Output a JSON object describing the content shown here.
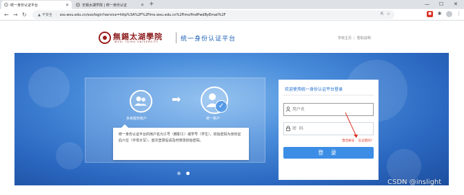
{
  "browser": {
    "tabs": [
      {
        "title": "统一身份认证平台",
        "active": true
      },
      {
        "title": "无锡太湖学院 | 统一身份认证",
        "active": false
      }
    ],
    "new_tab": "+",
    "window_controls": {
      "minimize": "—",
      "maximize": "☐",
      "close": "✕"
    },
    "nav": {
      "back": "←",
      "forward": "→",
      "reload": "↻"
    },
    "address": {
      "security_icon": "▲",
      "security_label": "不安全",
      "url": "sso.wxu.edu.cn/sso/login?service=http%3A%2F%2Fims.wxu.edu.cn%2Fims/findPwdByEmail%2F"
    }
  },
  "site": {
    "logo_cn": "無錫太湖學院",
    "logo_en": "WUXI TAIHU UNIVERSITY",
    "platform_title": "统一身份认证平台",
    "links": [
      "学校主页",
      "帮助说明"
    ]
  },
  "banner": {
    "multi_label": "多条服务账户",
    "single_label": "统一账户",
    "description": "统一身份认证平台的用户名为工号（教职工）或学号（学生），初始密码为身份证后六位（字母大写），首次登录后请及时修改初始密码。",
    "carousel_dots": 2,
    "active_dot": 2
  },
  "login": {
    "title": "欢迎使用统一身份认证平台登录",
    "username_placeholder": "用户名",
    "password_placeholder": "密  码",
    "help_link": "激活帐号",
    "forgot_link": "忘记密码?",
    "submit_label": "登 录"
  },
  "watermark": "CSDN @inslight",
  "colors": {
    "brand_red": "#8b1a1a",
    "platform_blue": "#1a5fb4",
    "button_blue": "#3b8de5",
    "annotation_red": "#d93025"
  }
}
